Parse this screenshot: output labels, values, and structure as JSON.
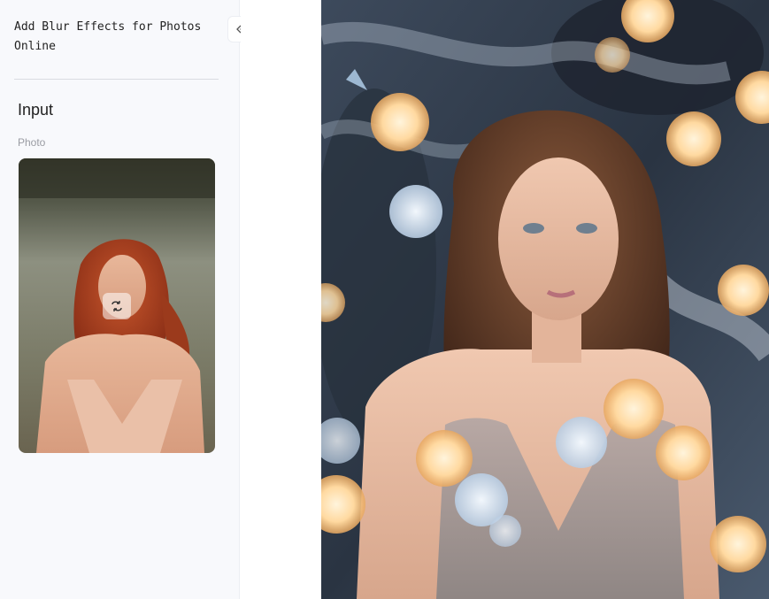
{
  "app": {
    "title": "Add Blur Effects for Photos Online"
  },
  "sidebar": {
    "collapse_icon": "double-chevron-left-icon",
    "section_title": "Input",
    "photo_field": {
      "label": "Photo",
      "swap_icon": "swap-icon"
    }
  },
  "result": {
    "image_subject": "portrait with bokeh light orbs"
  },
  "colors": {
    "sidebar_bg": "#f8f9fc",
    "divider": "#d9dbe1",
    "label_muted": "#9a9ca3",
    "bokeh_warm": "#ffd9a0",
    "bokeh_cool": "#dce8f5"
  }
}
